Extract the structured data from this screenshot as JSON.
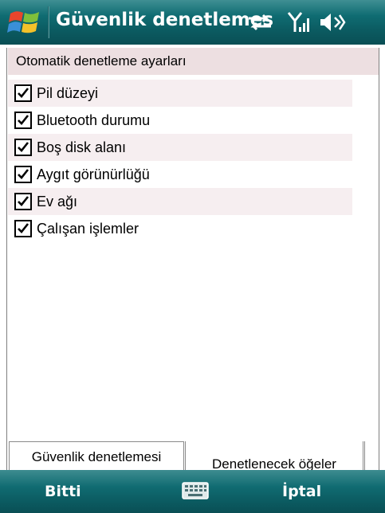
{
  "titlebar": {
    "title": "Güvenlik denetlemes",
    "icons": [
      "windows-start-icon",
      "sync-arrows-icon",
      "signal-strength-icon",
      "volume-icon"
    ]
  },
  "section": {
    "header": "Otomatik denetleme ayarları"
  },
  "items": [
    {
      "label": "Pil düzeyi",
      "checked": true
    },
    {
      "label": "Bluetooth durumu",
      "checked": true
    },
    {
      "label": "Boş disk alanı",
      "checked": true
    },
    {
      "label": "Aygıt görünürlüğü",
      "checked": true
    },
    {
      "label": "Ev ağı",
      "checked": true
    },
    {
      "label": "Çalışan işlemler",
      "checked": true
    }
  ],
  "tabs": [
    {
      "label": "Güvenlik denetlemesi",
      "active": false
    },
    {
      "label": "Denetlenecek öğeler",
      "active": true
    }
  ],
  "softkeys": {
    "left": "Bitti",
    "right": "İptal",
    "center_icon": "keyboard-icon"
  },
  "colors": {
    "titlebar": "#0f6c72",
    "header_bg": "#eddfe1",
    "alt_row": "#f6eef0"
  }
}
